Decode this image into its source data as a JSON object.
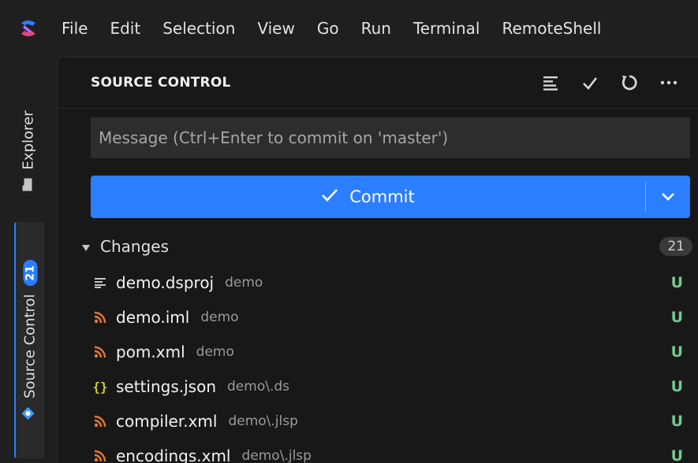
{
  "menu": [
    "File",
    "Edit",
    "Selection",
    "View",
    "Go",
    "Run",
    "Terminal",
    "RemoteShell"
  ],
  "activity": {
    "explorer_label": "Explorer",
    "scm_label": "Source Control",
    "scm_badge": "21"
  },
  "panel": {
    "title": "SOURCE CONTROL",
    "message_placeholder": "Message (Ctrl+Enter to commit on 'master')",
    "commit_label": "Commit"
  },
  "changes": {
    "label": "Changes",
    "count": "21",
    "files": [
      {
        "name": "demo.dsproj",
        "path": "demo",
        "status": "U",
        "icon": "lines-icon"
      },
      {
        "name": "demo.iml",
        "path": "demo",
        "status": "U",
        "icon": "rss-icon"
      },
      {
        "name": "pom.xml",
        "path": "demo",
        "status": "U",
        "icon": "rss-icon"
      },
      {
        "name": "settings.json",
        "path": "demo\\.ds",
        "status": "U",
        "icon": "json-braces-icon"
      },
      {
        "name": "compiler.xml",
        "path": "demo\\.jlsp",
        "status": "U",
        "icon": "rss-icon"
      },
      {
        "name": "encodings.xml",
        "path": "demo\\.jlsp",
        "status": "U",
        "icon": "rss-icon"
      }
    ]
  },
  "colors": {
    "accent": "#2b7fff",
    "untracked": "#73c991",
    "xml_icon": "#e37933",
    "json_icon": "#cbcb41"
  }
}
